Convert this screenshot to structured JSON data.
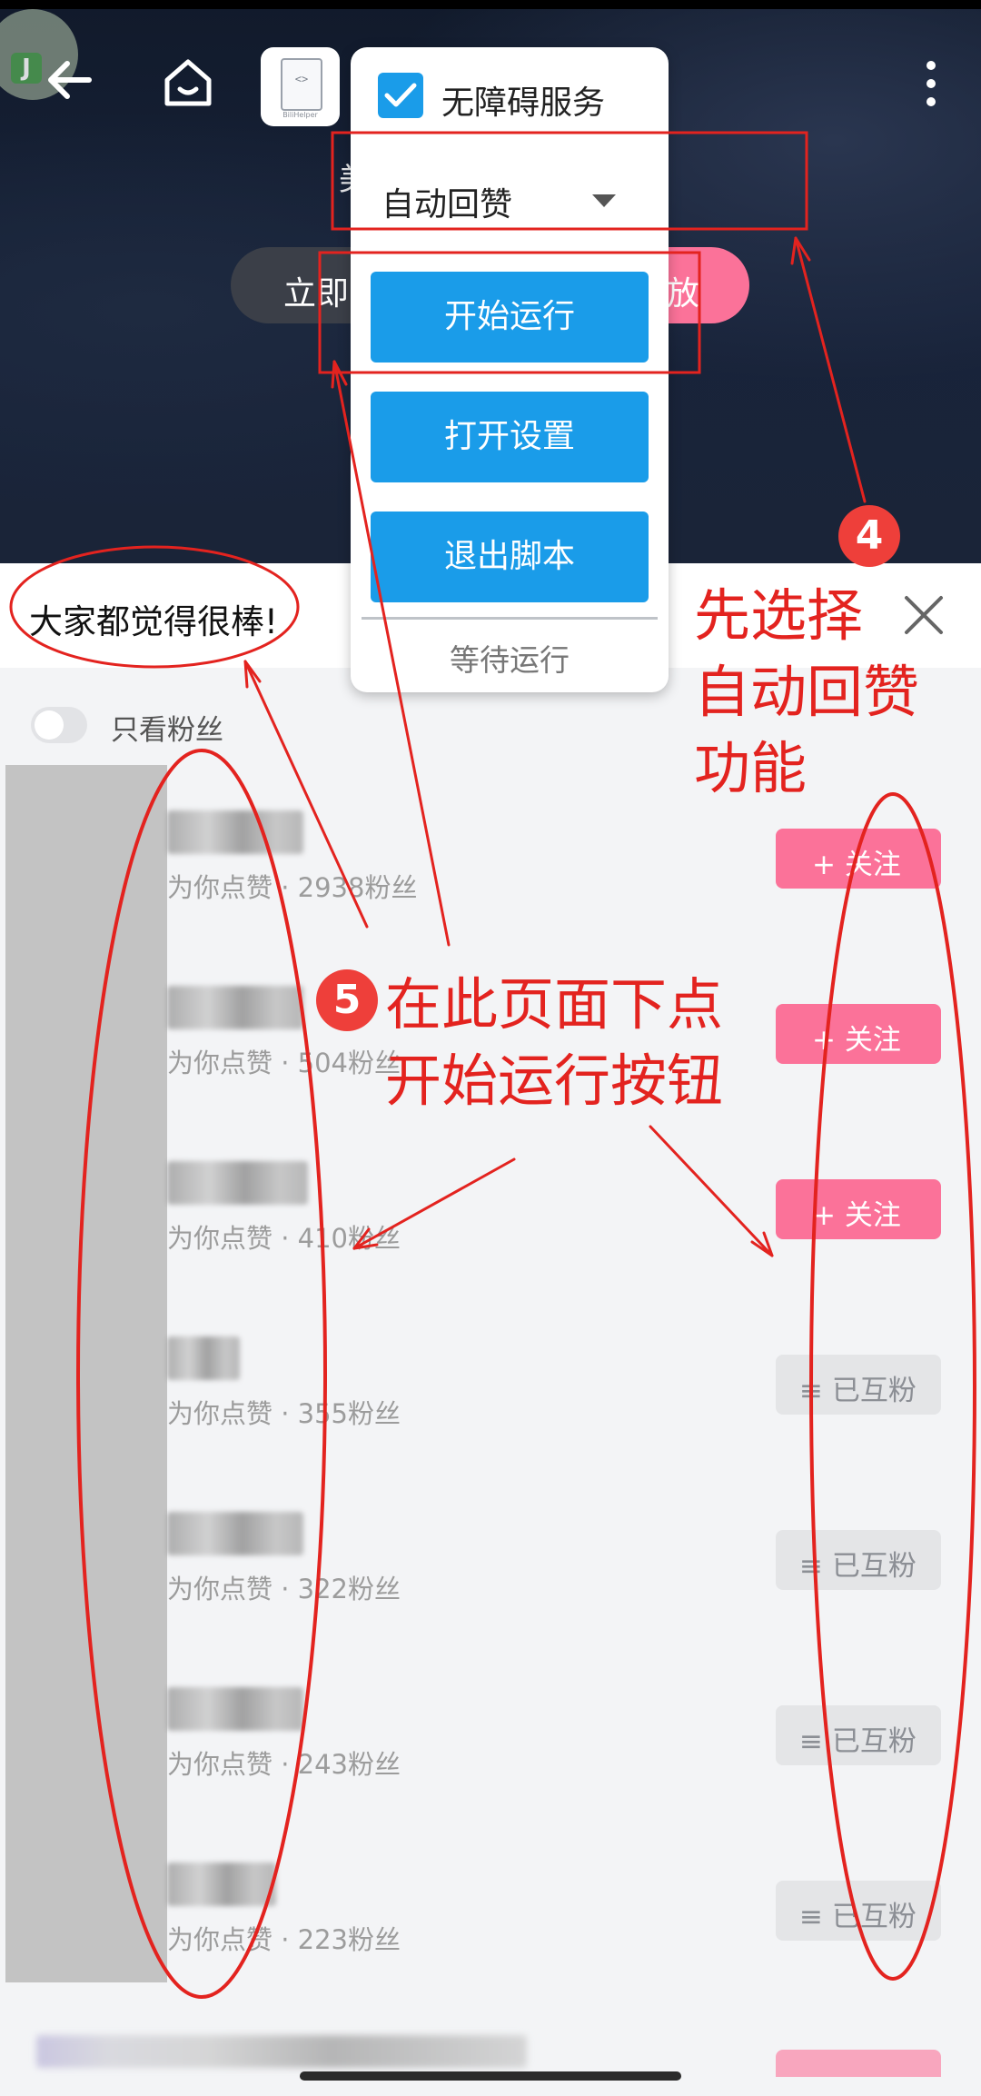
{
  "app_tile": {
    "caption": "BiliHelper",
    "glyph": "<>"
  },
  "background": {
    "partial_text": "美",
    "left_pill": "立即",
    "right_pill": "放"
  },
  "popup": {
    "checkbox_label": "无障碍服务",
    "checkbox_checked": true,
    "dropdown_value": "自动回赞",
    "buttons": [
      "开始运行",
      "打开设置",
      "退出脚本"
    ],
    "status": "等待运行",
    "accent_color": "#1a9ce9"
  },
  "header": {
    "comment": "大家都觉得很棒!"
  },
  "filter": {
    "toggle_label": "只看粉丝",
    "toggle_on": false
  },
  "list": {
    "rows": [
      {
        "subtitle": "为你点赞 · 2938粉丝",
        "action": "+ 关注",
        "state": "follow"
      },
      {
        "subtitle": "为你点赞 · 504粉丝",
        "action": "+ 关注",
        "state": "follow"
      },
      {
        "subtitle": "为你点赞 · 410粉丝",
        "action": "+ 关注",
        "state": "follow"
      },
      {
        "subtitle": "为你点赞 · 355粉丝",
        "action": "≡ 已互粉",
        "state": "mutual"
      },
      {
        "subtitle": "为你点赞 · 322粉丝",
        "action": "≡ 已互粉",
        "state": "mutual"
      },
      {
        "subtitle": "为你点赞 · 243粉丝",
        "action": "≡ 已互粉",
        "state": "mutual"
      },
      {
        "subtitle": "为你点赞 · 223粉丝",
        "action": "≡ 已互粉",
        "state": "mutual"
      }
    ]
  },
  "annotations": {
    "step4_number": "4",
    "step4_text": [
      "先选择",
      "自动回赞",
      "功能"
    ],
    "step5_number": "5",
    "step5_text": [
      "在此页面下点",
      "开始运行按钮"
    ],
    "color": "#e3231f"
  },
  "colors": {
    "pink": "#fb7299",
    "mutual_bg": "#e4e5e7"
  }
}
